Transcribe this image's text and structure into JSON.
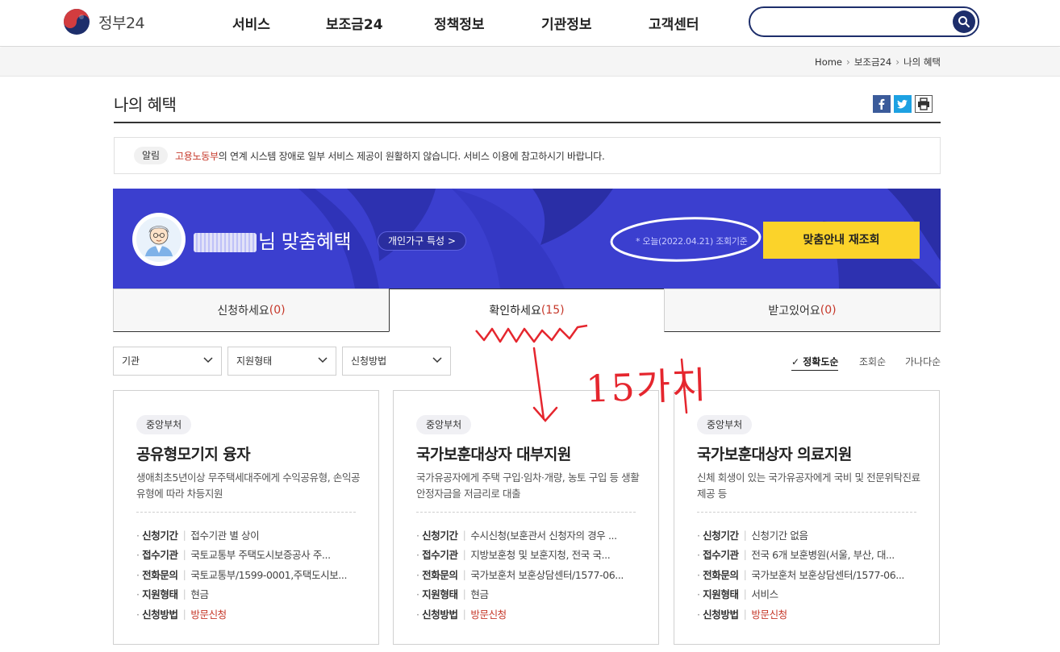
{
  "header": {
    "logo_text": "정부24",
    "menu": [
      "서비스",
      "보조금24",
      "정책정보",
      "기관정보",
      "고객센터"
    ],
    "search_placeholder": ""
  },
  "breadcrumb": [
    "Home",
    "보조금24",
    "나의 혜택"
  ],
  "page": {
    "title": "나의 혜택",
    "share": [
      "facebook-icon",
      "twitter-icon",
      "print-icon"
    ]
  },
  "notice": {
    "badge": "알림",
    "highlight": "고용노동부",
    "text": "의 연계 시스템 장애로 일부 서비스 제공이 원활하지 않습니다. 서비스 이용에 참고하시기 바랍니다."
  },
  "banner": {
    "title_suffix": "님 맞춤혜택",
    "household_tag": "개인가구 특성 >",
    "asof": "* 오늘(2022.04.21) 조회기준",
    "recheck_label": "맞춤안내 재조회",
    "color": "#3b3fcf",
    "button_color": "#fbd32a"
  },
  "tabs": [
    {
      "label": "신청하세요",
      "count": "(0)",
      "active": false
    },
    {
      "label": "확인하세요",
      "count": "(15)",
      "active": true
    },
    {
      "label": "받고있어요",
      "count": "(0)",
      "active": false
    }
  ],
  "filters": [
    "기관",
    "지원형태",
    "신청방법"
  ],
  "sort": [
    "정확도순",
    "조회순",
    "가나다순"
  ],
  "cards": [
    {
      "org": "중앙부처",
      "title": "공유형모기지 융자",
      "desc": "생애최초5년이상 무주택세대주에게 수익공유형, 손익공유형에 따라 차등지원",
      "rows": [
        {
          "k": "신청기간",
          "v": "접수기관 별 상이"
        },
        {
          "k": "접수기관",
          "v": "국토교통부 주택도시보증공사 주..."
        },
        {
          "k": "전화문의",
          "v": "국토교통부/1599-0001,주택도시보..."
        },
        {
          "k": "지원형태",
          "v": "현금"
        },
        {
          "k": "신청방법",
          "v": "방문신청"
        }
      ]
    },
    {
      "org": "중앙부처",
      "title": "국가보훈대상자 대부지원",
      "desc": "국가유공자에게 주택 구입·임차·개량, 농토 구입 등 생활안정자금을 저금리로 대출",
      "rows": [
        {
          "k": "신청기간",
          "v": "수시신청(보훈관서 신청자의 경우 ..."
        },
        {
          "k": "접수기관",
          "v": "지방보훈청 및 보훈지청, 전국 국..."
        },
        {
          "k": "전화문의",
          "v": "국가보훈처 보훈상담센터/1577-06..."
        },
        {
          "k": "지원형태",
          "v": "현금"
        },
        {
          "k": "신청방법",
          "v": "방문신청"
        }
      ]
    },
    {
      "org": "중앙부처",
      "title": "국가보훈대상자 의료지원",
      "desc": "신체 회생이 있는 국가유공자에게 국비 및 전문위탁진료 제공 등",
      "rows": [
        {
          "k": "신청기간",
          "v": "신청기간 없음"
        },
        {
          "k": "접수기관",
          "v": "전국 6개 보훈병원(서울, 부산, 대..."
        },
        {
          "k": "전화문의",
          "v": "국가보훈처 보훈상담센터/1577-06..."
        },
        {
          "k": "지원형태",
          "v": "서비스"
        },
        {
          "k": "신청방법",
          "v": "방문신청"
        }
      ]
    }
  ],
  "annotation": {
    "handwritten": "15가지",
    "color": "#e5262e"
  }
}
